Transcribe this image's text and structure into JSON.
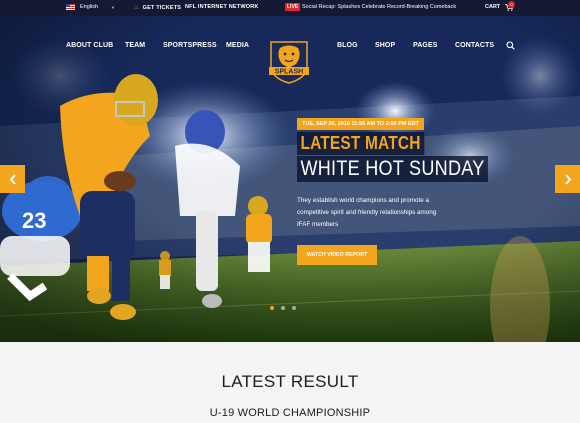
{
  "topbar": {
    "language": "English",
    "tickets": "GET TICKETS",
    "network": "NFL INTERNET NETWORK",
    "live_badge": "LIVE",
    "news": "Social Recap: Splashes Celebrate Record-Breaking Comeback",
    "cart_label": "CART",
    "cart_count": "0"
  },
  "nav": {
    "left": [
      "ABOUT CLUB",
      "TEAM",
      "SPORTSPRESS",
      "MEDIA"
    ],
    "right": [
      "BLOG",
      "SHOP",
      "PAGES",
      "CONTACTS"
    ],
    "logo_text": "SPLASH"
  },
  "hero": {
    "date": "TUE, SEP 20, 2016 11:55 AM TO 2:00 PM EDT",
    "title_line1": "LATEST MATCH",
    "title_line2": "WHITE HOT SUNDAY",
    "description": "They establish world champions and promote a competitive spirit and friendly relationships among IFAF members",
    "button": "WATCH VIDEO REPORT",
    "slides": 3,
    "active_slide": 1
  },
  "results": {
    "heading": "LATEST RESULT",
    "subheading": "U-19 WORLD CHAMPIONSHIP"
  },
  "colors": {
    "accent": "#f3a51e",
    "topbar": "#141a33",
    "live": "#e8232a"
  }
}
